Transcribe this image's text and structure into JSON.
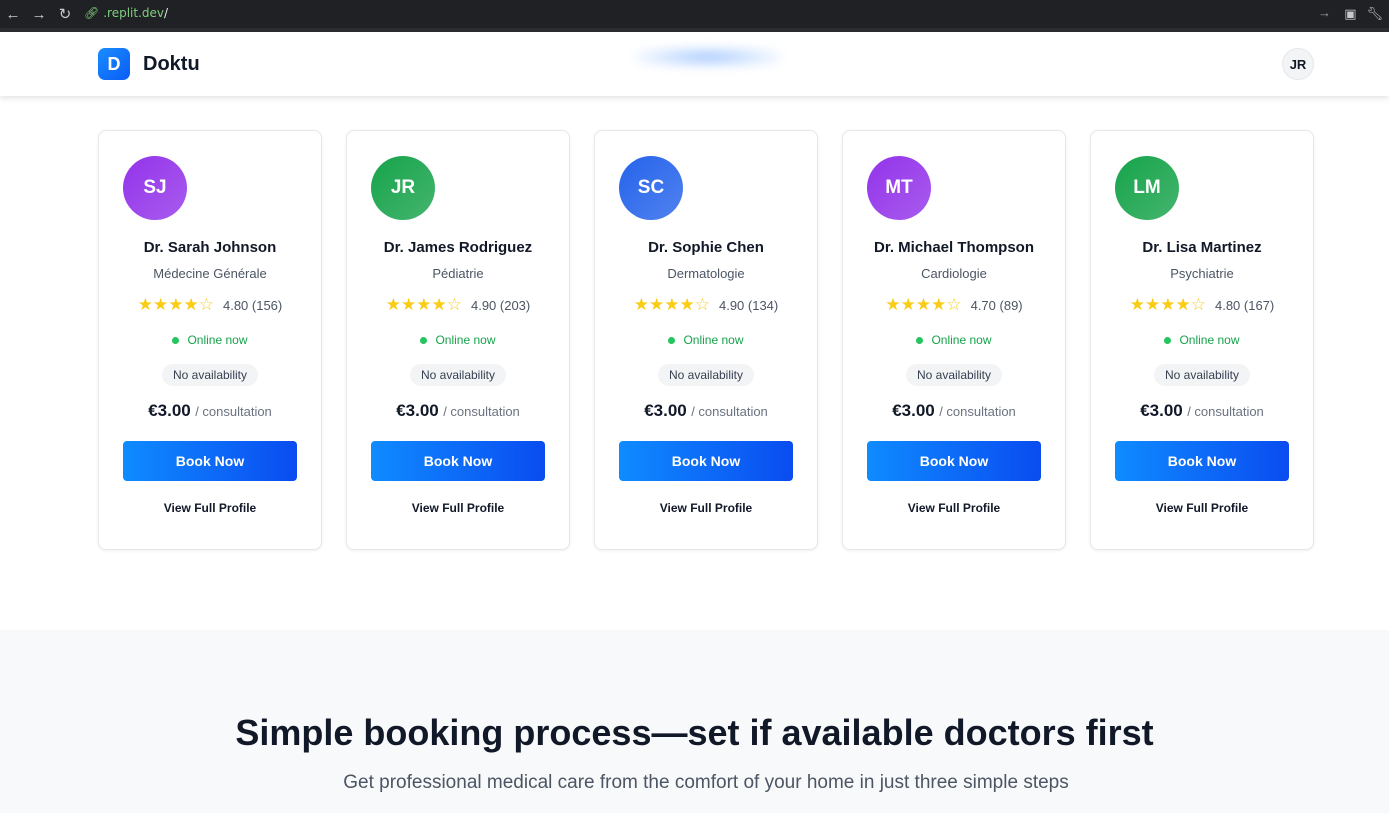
{
  "browser": {
    "url_host": ".replit.dev",
    "url_path": "/"
  },
  "header": {
    "logo_letter": "D",
    "brand": "Doktu",
    "user_initials": "JR"
  },
  "doctors": [
    {
      "initials": "SJ",
      "color": "#9333ea",
      "name": "Dr. Sarah Johnson",
      "specialty": "Médecine Générale",
      "stars": 4,
      "rating": "4.80 (156)",
      "status": "Online now",
      "availability": "No availability",
      "price": "€3.00",
      "price_unit": "/ consultation",
      "book": "Book Now",
      "profile": "View Full Profile"
    },
    {
      "initials": "JR",
      "color": "#16a34a",
      "name": "Dr. James Rodriguez",
      "specialty": "Pédiatrie",
      "stars": 4,
      "rating": "4.90 (203)",
      "status": "Online now",
      "availability": "No availability",
      "price": "€3.00",
      "price_unit": "/ consultation",
      "book": "Book Now",
      "profile": "View Full Profile"
    },
    {
      "initials": "SC",
      "color": "#2563eb",
      "name": "Dr. Sophie Chen",
      "specialty": "Dermatologie",
      "stars": 4,
      "rating": "4.90 (134)",
      "status": "Online now",
      "availability": "No availability",
      "price": "€3.00",
      "price_unit": "/ consultation",
      "book": "Book Now",
      "profile": "View Full Profile"
    },
    {
      "initials": "MT",
      "color": "#9333ea",
      "name": "Dr. Michael Thompson",
      "specialty": "Cardiologie",
      "stars": 4,
      "rating": "4.70 (89)",
      "status": "Online now",
      "availability": "No availability",
      "price": "€3.00",
      "price_unit": "/ consultation",
      "book": "Book Now",
      "profile": "View Full Profile"
    },
    {
      "initials": "LM",
      "color": "#16a34a",
      "name": "Dr. Lisa Martinez",
      "specialty": "Psychiatrie",
      "stars": 4,
      "rating": "4.80 (167)",
      "status": "Online now",
      "availability": "No availability",
      "price": "€3.00",
      "price_unit": "/ consultation",
      "book": "Book Now",
      "profile": "View Full Profile"
    }
  ],
  "how_it_works": {
    "title": "Simple booking process—set if available doctors first",
    "subtitle": "Get professional medical care from the comfort of your home in just three simple steps"
  }
}
